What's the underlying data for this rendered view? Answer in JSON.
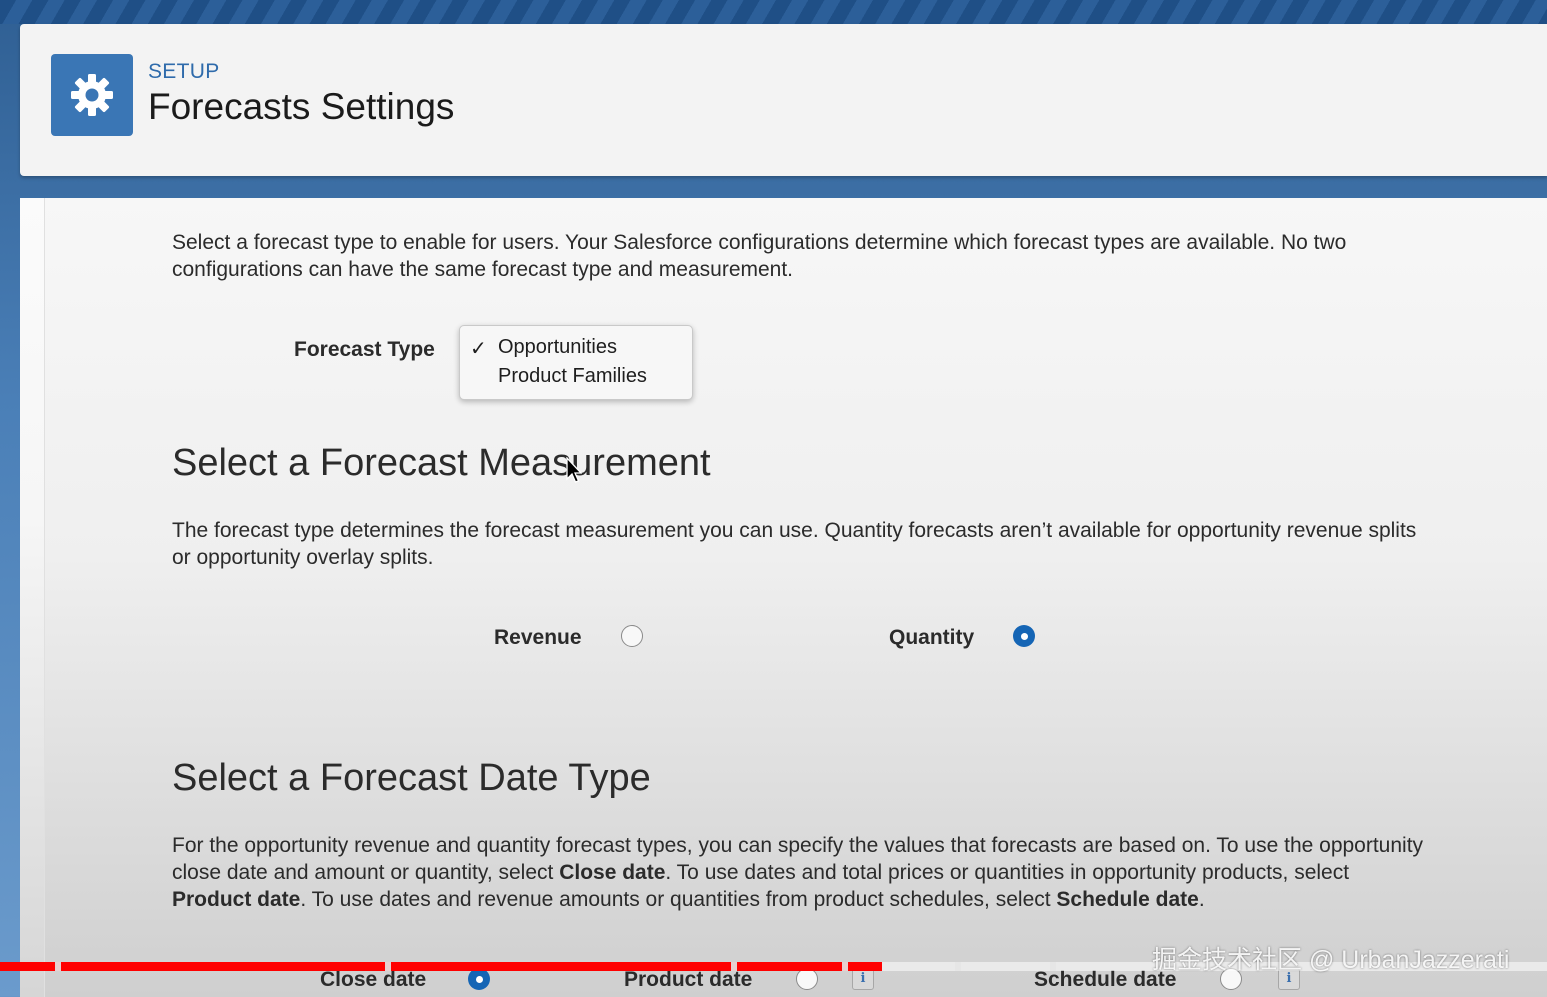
{
  "header": {
    "setup_label": "SETUP",
    "title": "Forecasts Settings",
    "icon": "gear-icon"
  },
  "intro": {
    "line1": "Select a forecast type to enable for users. Your Salesforce configurations determine which forecast types are available. No two",
    "line2": "configurations can have the same forecast type and measurement."
  },
  "forecast_type": {
    "label": "Forecast Type",
    "options": [
      "Opportunities",
      "Product Families"
    ],
    "selected": "Opportunities"
  },
  "measurement": {
    "heading": "Select a Forecast Measurement",
    "desc_line1": "The forecast type determines the forecast measurement you can use. Quantity forecasts aren’t available for opportunity revenue splits",
    "desc_line2": "or opportunity overlay splits.",
    "options": [
      {
        "label": "Revenue",
        "selected": false
      },
      {
        "label": "Quantity",
        "selected": true
      }
    ]
  },
  "date_type": {
    "heading": "Select a Forecast Date Type",
    "desc": {
      "l1": "For the opportunity revenue and quantity forecast types, you can specify the values that forecasts are based on. To use the opportunity",
      "l2a": "close date and amount or quantity, select ",
      "l2b": "Close date",
      "l2c": ". To use dates and total prices or quantities in opportunity products, select",
      "l3a": "Product date",
      "l3b": ". To use dates and revenue amounts or quantities from product schedules, select ",
      "l3c": "Schedule date",
      "l3d": "."
    },
    "options": [
      {
        "label": "Close date",
        "selected": true
      },
      {
        "label": "Product date",
        "selected": false,
        "info": "i"
      },
      {
        "label": "Schedule date",
        "selected": false,
        "info": "i"
      }
    ]
  },
  "video": {
    "progress_fraction": 0.57,
    "watermark": "掘金技术社区 @ UrbanJazzerati"
  },
  "colors": {
    "accent": "#1565b5",
    "icon_bg": "#3a76b5",
    "progress": "#ff0000"
  }
}
